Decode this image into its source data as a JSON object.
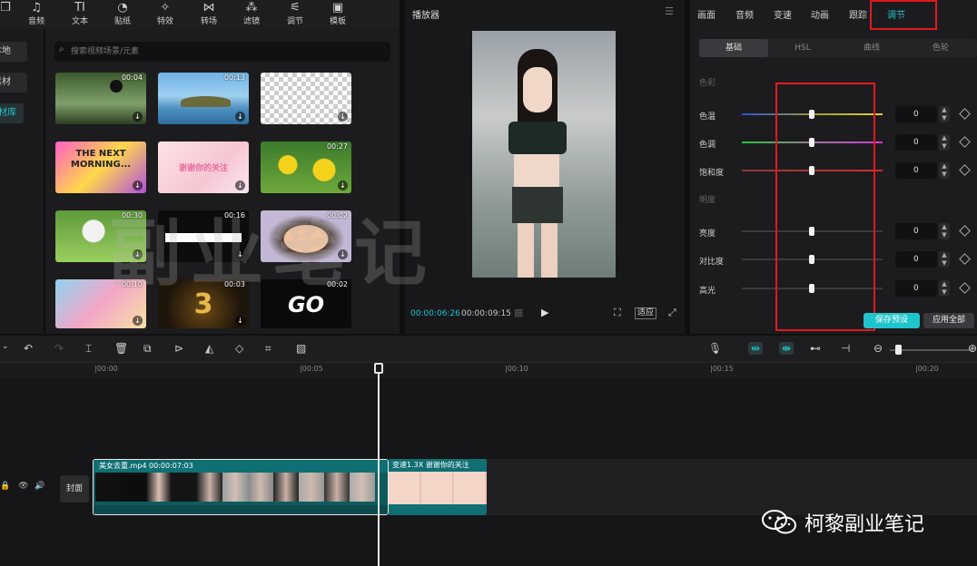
{
  "toolbar": {
    "items": [
      {
        "label": "音频",
        "icon": "music-note-icon"
      },
      {
        "label": "文本",
        "icon": "text-icon"
      },
      {
        "label": "贴纸",
        "icon": "sticker-icon"
      },
      {
        "label": "特效",
        "icon": "sparkle-icon"
      },
      {
        "label": "转场",
        "icon": "transition-icon"
      },
      {
        "label": "滤镜",
        "icon": "filter-icon"
      },
      {
        "label": "调节",
        "icon": "sliders-icon"
      },
      {
        "label": "模板",
        "icon": "template-icon"
      }
    ]
  },
  "sidebar": {
    "items": [
      {
        "label": "本地"
      },
      {
        "label": "素材"
      },
      {
        "label": "素材库",
        "active": true
      }
    ]
  },
  "library": {
    "search_placeholder": "搜索视频场景/元素",
    "thumbs": [
      {
        "duration": "00:04"
      },
      {
        "duration": "00:13"
      },
      {
        "duration": ""
      },
      {
        "duration": "",
        "text": "THE NEXT MORNING..."
      },
      {
        "duration": "",
        "text": "谢谢你的关注"
      },
      {
        "duration": "00:27"
      },
      {
        "duration": "00:30"
      },
      {
        "duration": "00:16"
      },
      {
        "duration": "00:02"
      },
      {
        "duration": "00:10"
      },
      {
        "duration": "00:03",
        "text": "3"
      },
      {
        "duration": "00:02",
        "text": "GO"
      }
    ]
  },
  "player": {
    "title": "播放器",
    "time_current": "00:00:06:26",
    "time_total": "00:00:09:15",
    "fit_label": "适应"
  },
  "adjust": {
    "tabs": [
      "画面",
      "音频",
      "变速",
      "动画",
      "跟踪",
      "调节"
    ],
    "active_tab": "调节",
    "subtabs": [
      "基础",
      "HSL",
      "曲线",
      "色轮"
    ],
    "section_color": "色彩",
    "section_light": "明度",
    "rows": [
      {
        "label": "色温",
        "value": "0"
      },
      {
        "label": "色调",
        "value": "0"
      },
      {
        "label": "饱和度",
        "value": "0"
      },
      {
        "label": "亮度",
        "value": "0"
      },
      {
        "label": "对比度",
        "value": "0"
      },
      {
        "label": "高光",
        "value": "0"
      }
    ],
    "save_preset": "保存预设",
    "apply_all": "应用全部"
  },
  "timeline": {
    "ticks": [
      "|00:00",
      "|00:05",
      "|00:10",
      "|00:15",
      "|00:20"
    ],
    "cover_label": "封面",
    "clip1_label": "美女去重.mp4  00:00:07:03",
    "clip2_label": "变速1.3X  谢谢你的关注"
  },
  "watermark": "副业笔记",
  "brand": "柯黎副业笔记",
  "colors": {
    "accent": "#20c4cc",
    "highlight": "#e0191e"
  }
}
